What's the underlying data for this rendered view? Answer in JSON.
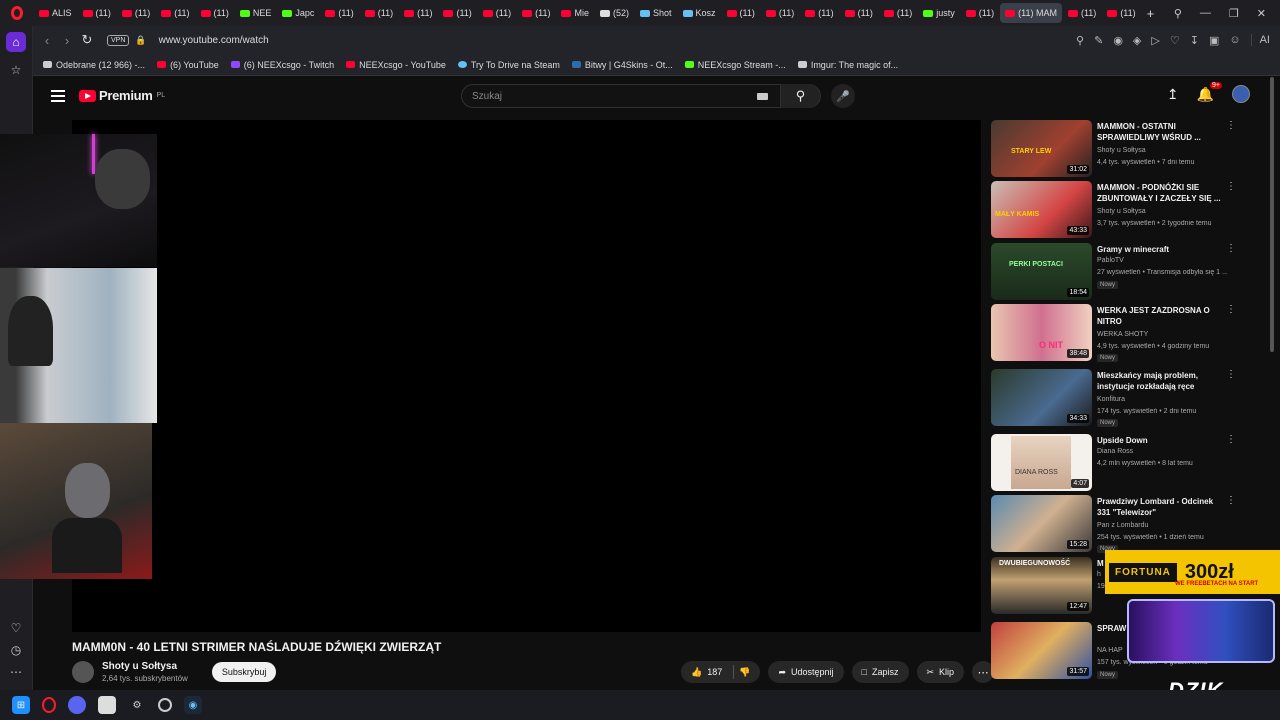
{
  "tabs": [
    "ALIS",
    "(11)",
    "(11)",
    "(11)",
    "(11)",
    "NEE",
    "Japc",
    "(11)",
    "(11)",
    "(11)",
    "(11)",
    "(11)",
    "(11)",
    "Mie",
    "(52)",
    "Shot",
    "Kosz",
    "(11)",
    "(11)",
    "(11)",
    "(11)",
    "(11)",
    "justy",
    "(11)",
    "(11) MAM",
    "(11)",
    "(11)"
  ],
  "address": {
    "vpn": "VPN",
    "url": "www.youtube.com/watch",
    "ai": "AI"
  },
  "bookmarks": [
    "Odebrane (12 966) -...",
    "(6) YouTube",
    "(6) NEEXcsgo - Twitch",
    "NEEXcsgo - YouTube",
    "Try To Drive na Steam",
    "Bitwy | G4Skins - Ot...",
    "NEEXcsgo Stream -...",
    "Imgur: The magic of..."
  ],
  "header": {
    "logo": "Premium",
    "region": "PL",
    "search_placeholder": "Szukaj",
    "notif_count": "9+"
  },
  "video": {
    "title": "MAMM0N - 40 LETNI STRIMER NAŚLADUJE DŹWIĘKI ZWIERZĄT",
    "channel": "Shoty u Sołtysa",
    "subscribers": "2,64 tys. subskrybentów",
    "subscribe_label": "Subskrybuj",
    "likes": "187",
    "share_label": "Udostępnij",
    "save_label": "Zapisz",
    "clip_label": "Klip"
  },
  "recommended": [
    {
      "title": "MAMMON - OSTATNI SPRAWIEDLIWY WŚRUD ...",
      "channel": "Shoty u Sołtysa",
      "meta": "4,4 tys. wyświetleń • 7 dni temu",
      "duration": "31:02",
      "new": ""
    },
    {
      "title": "MAMMON - PODNÓŻKI SIE ZBUNTOWAŁY I ZACZEŁY SIĘ ...",
      "channel": "Shoty u Sołtysa",
      "meta": "3,7 tys. wyświetleń • 2 tygodnie temu",
      "duration": "43:33",
      "new": ""
    },
    {
      "title": "Gramy  w minecraft",
      "channel": "PabloTV",
      "meta": "27 wyświetleń • Transmisja odbyła się 1 ...",
      "duration": "18:54",
      "new": "Nowy"
    },
    {
      "title": "WERKA JEST ZAZDROSNA O NITRO",
      "channel": "WERKA SHOTY",
      "meta": "4,9 tys. wyświetleń • 4 godziny temu",
      "duration": "38:48",
      "new": "Nowy"
    },
    {
      "title": "Mieszkańcy mają problem, instytucje rozkładają ręce",
      "channel": "Konfitura",
      "meta": "174 tys. wyświetleń • 2 dni temu",
      "duration": "34:33",
      "new": "Nowy"
    },
    {
      "title": "Upside Down",
      "channel": "Diana Ross",
      "meta": "4,2 mln wyświetleń • 8 lat temu",
      "duration": "4:07",
      "new": ""
    },
    {
      "title": "Prawdziwy Lombard - Odcinek 331 \"Telewizor\"",
      "channel": "Pan z Lombardu",
      "meta": "254 tys. wyświetleń • 1 dzień temu",
      "duration": "15:28",
      "new": "Nowy"
    },
    {
      "title": "M",
      "channel": "h",
      "meta": "19",
      "duration": "12:47",
      "new": ""
    },
    {
      "title": "SPRAW PIZZER",
      "channel": "NA HAP",
      "meta": "157 tys. wyświetleń • 6 godzin temu",
      "duration": "31:57",
      "new": "Nowy"
    }
  ],
  "overlays": {
    "fortuna": "FORTUNA",
    "fortuna_amount": "300zł",
    "fortuna_sub": "WE FREEBETACH NA START",
    "dzik": "DZIK",
    "thumb_texts": [
      "STARY LEW",
      "MAŁY KAMIS",
      "PERKI POSTACI",
      "O NIT",
      "DIANA ROSS",
      "DWUBIEGUNOWOŚĆ"
    ]
  },
  "colors": {
    "yt_red": "#ff0033",
    "bg": "#0f0f0f",
    "fortuna": "#f5c400"
  }
}
